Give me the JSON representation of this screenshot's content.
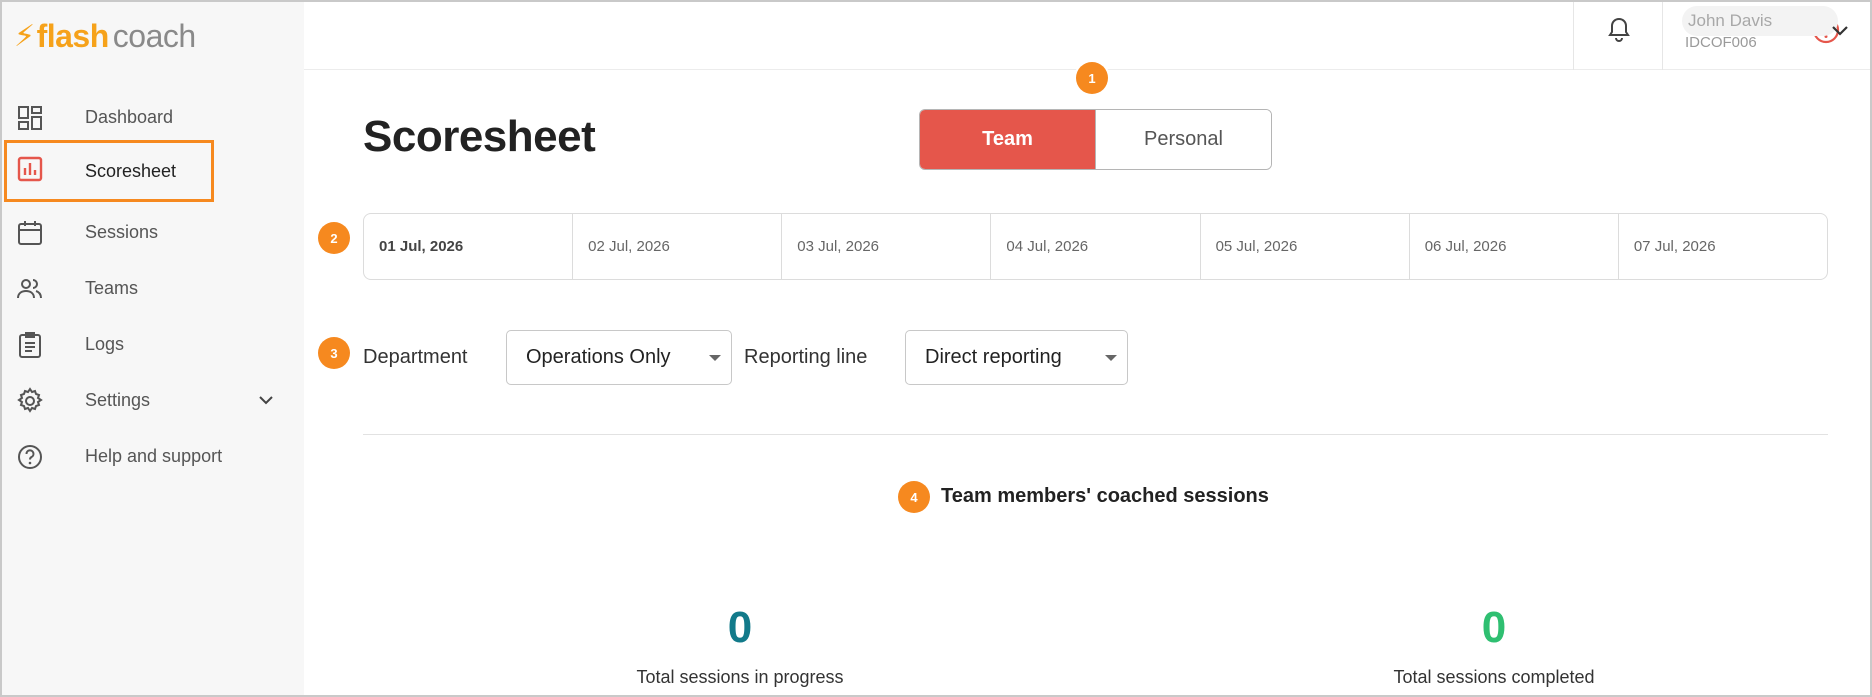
{
  "logo": {
    "bolt": "⚡",
    "flash": "flash",
    "coach": "coach"
  },
  "colors": {
    "accent": "#f6891f",
    "brand_orange": "#f6a21a",
    "team_red": "#e5564b",
    "progress_teal": "#127a8a",
    "completed_green": "#2fbf71"
  },
  "sidebar": {
    "items": [
      {
        "label": "Dashboard",
        "icon": "dashboard-icon"
      },
      {
        "label": "Scoresheet",
        "icon": "bar-chart-icon",
        "active": true
      },
      {
        "label": "Sessions",
        "icon": "calendar-icon"
      },
      {
        "label": "Teams",
        "icon": "people-icon"
      },
      {
        "label": "Logs",
        "icon": "clipboard-icon"
      },
      {
        "label": "Settings",
        "icon": "gear-icon",
        "expandable": true
      },
      {
        "label": "Help and support",
        "icon": "question-circle-icon"
      }
    ]
  },
  "header": {
    "user_name": "John Davis",
    "user_id": "IDCOF006"
  },
  "main": {
    "title": "Scoresheet",
    "toggle": {
      "team": "Team",
      "personal": "Personal",
      "selected": "Team"
    },
    "dates": [
      "01 Jul, 2026",
      "02 Jul, 2026",
      "03 Jul, 2026",
      "04 Jul, 2026",
      "05 Jul, 2026",
      "06 Jul, 2026",
      "07 Jul, 2026"
    ],
    "selected_date": "01 Jul, 2026",
    "filters": {
      "department_label": "Department",
      "department_value": "Operations Only",
      "reporting_label": "Reporting line",
      "reporting_value": "Direct reporting"
    },
    "section_title": "Team members' coached sessions",
    "stats": {
      "in_progress": {
        "value": "0",
        "label": "Total sessions in progress"
      },
      "completed": {
        "value": "0",
        "label": "Total sessions completed"
      }
    }
  },
  "badges": [
    "1",
    "2",
    "3",
    "4"
  ]
}
